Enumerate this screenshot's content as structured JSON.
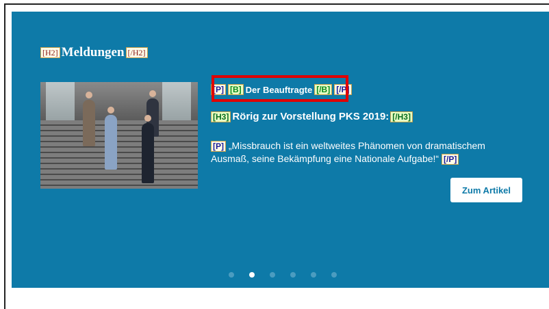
{
  "heading": {
    "open_tag": "[H2]",
    "text": "Meldungen",
    "close_tag": "[/H2]"
  },
  "article": {
    "kicker": {
      "p_open": "[P]",
      "b_open": "[B]",
      "text": "Der Beauftragte",
      "b_close": "[/B]",
      "p_close": "[/P]"
    },
    "title": {
      "open_tag": "[H3]",
      "text": "Rörig zur Vorstellung PKS 2019:",
      "close_tag": "[/H3]"
    },
    "summary": {
      "open_tag": "[P]",
      "text": "„Missbrauch ist ein weltweites Phänomen von dramatischem Ausmaß, seine Bekämpfung eine Nationale Aufgabe!“",
      "close_tag": "[/P]"
    },
    "button_label": "Zum Artikel"
  },
  "carousel": {
    "slide_count": 6,
    "active_index": 1
  },
  "colors": {
    "panel_bg": "#0e7aa8",
    "highlight": "#e00000"
  }
}
